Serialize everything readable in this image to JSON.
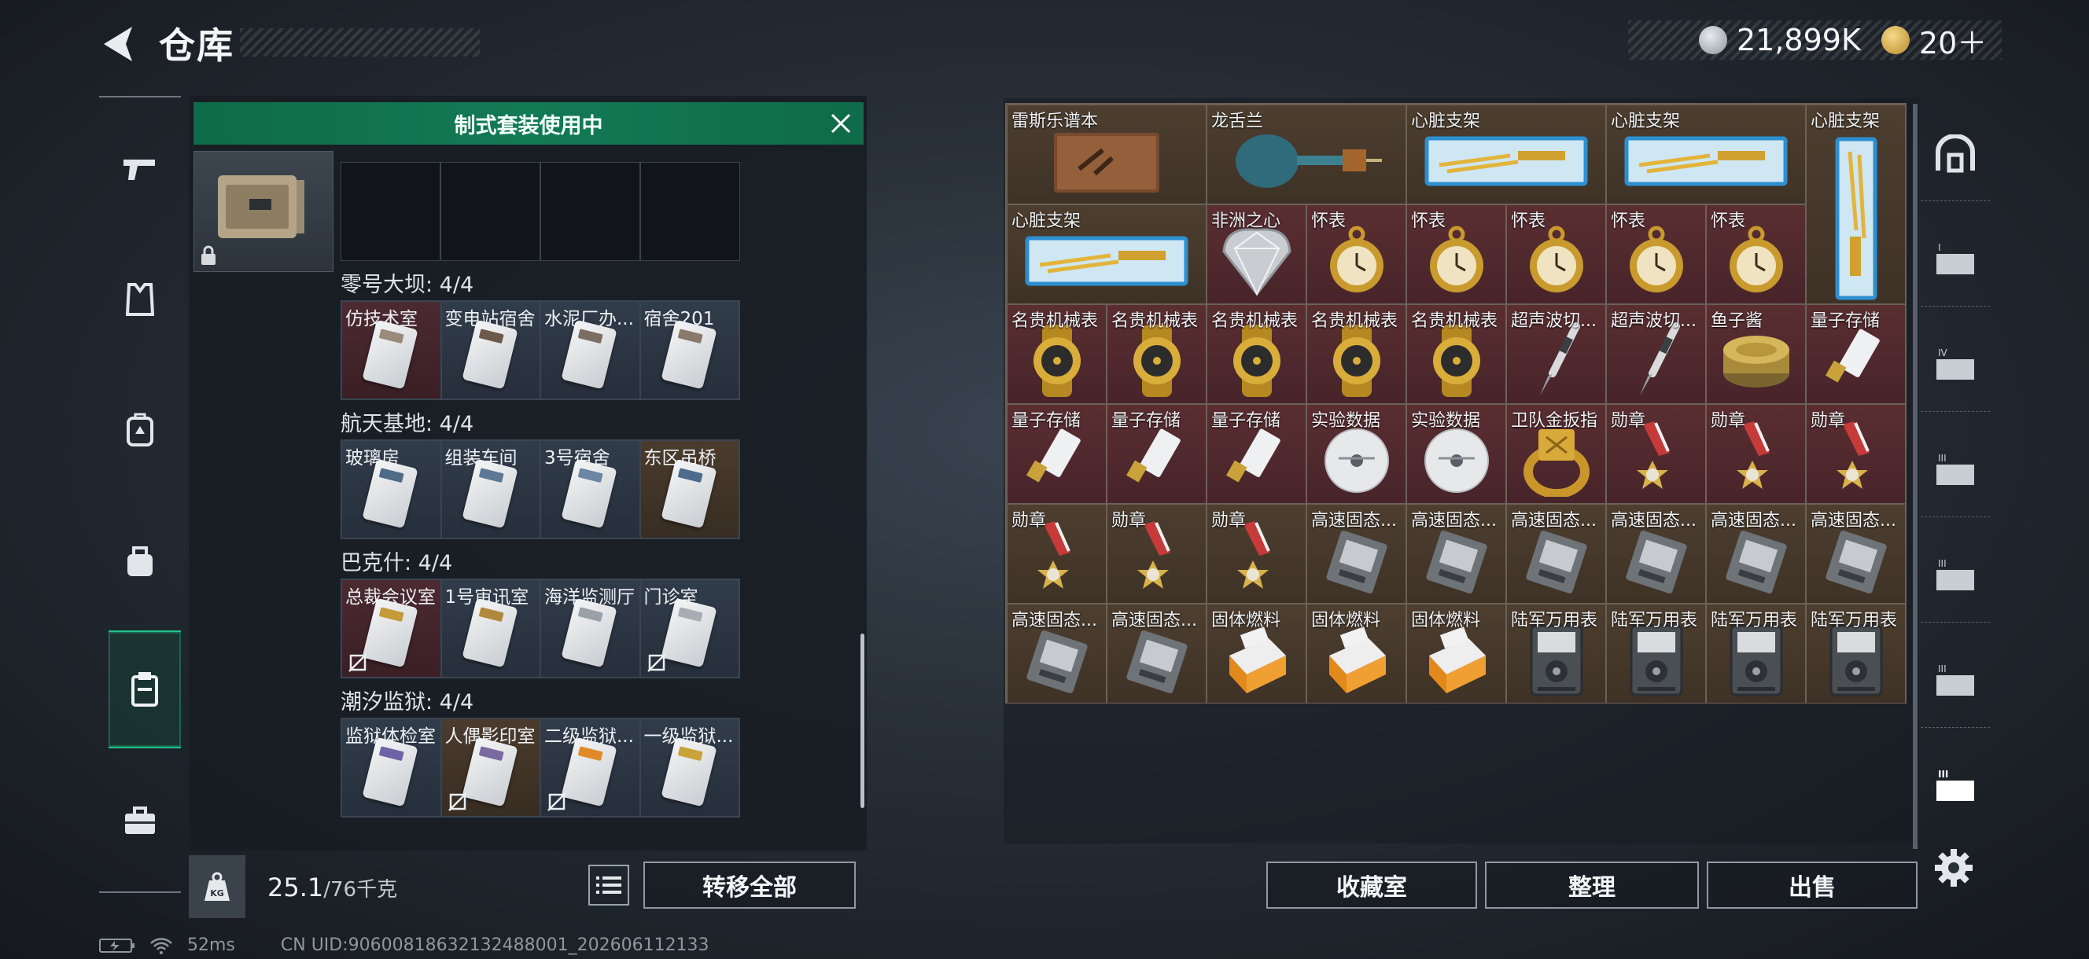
{
  "header": {
    "title": "仓库",
    "currency_1": "21,899K",
    "currency_2": "20＋"
  },
  "kit": {
    "banner": "制式套装使用中"
  },
  "sections": [
    {
      "title": "零号大坝: 4/4",
      "cards": [
        {
          "label": "仿技术室",
          "tone": "red",
          "locked": false,
          "color": "#9a8a7a"
        },
        {
          "label": "变电站宿舍",
          "tone": "blue",
          "locked": false,
          "color": "#6b5a4c"
        },
        {
          "label": "水泥厂办...",
          "tone": "blue",
          "locked": false,
          "color": "#7a6e62"
        },
        {
          "label": "宿舍201",
          "tone": "blue",
          "locked": false,
          "color": "#8a7a6c"
        }
      ]
    },
    {
      "title": "航天基地: 4/4",
      "cards": [
        {
          "label": "玻璃房",
          "tone": "blue",
          "locked": false,
          "color": "#4f6b86"
        },
        {
          "label": "组装车间",
          "tone": "blue",
          "locked": false,
          "color": "#5c7894"
        },
        {
          "label": "3号宿舍",
          "tone": "blue",
          "locked": false,
          "color": "#6a86a2"
        },
        {
          "label": "东区吊桥",
          "tone": "brown",
          "locked": false,
          "color": "#4d6b8a"
        }
      ]
    },
    {
      "title": "巴克什: 4/4",
      "cards": [
        {
          "label": "总裁会议室",
          "tone": "red",
          "locked": true,
          "color": "#c59a3a"
        },
        {
          "label": "1号审讯室",
          "tone": "blue",
          "locked": false,
          "color": "#b08a3c"
        },
        {
          "label": "海洋监测厅",
          "tone": "blue",
          "locked": false,
          "color": "#9aa0a8"
        },
        {
          "label": "门诊室",
          "tone": "blue",
          "locked": true,
          "color": "#a8adb3"
        }
      ]
    },
    {
      "title": "潮汐监狱: 4/4",
      "cards": [
        {
          "label": "监狱体检室",
          "tone": "blue",
          "locked": false,
          "color": "#6e63a8"
        },
        {
          "label": "人偶影印室",
          "tone": "brown",
          "locked": true,
          "color": "#7a6aa0"
        },
        {
          "label": "二级监狱...",
          "tone": "blue",
          "locked": true,
          "color": "#e08a2a"
        },
        {
          "label": "一级监狱...",
          "tone": "blue",
          "locked": false,
          "color": "#c9a23a"
        }
      ]
    }
  ],
  "weight": {
    "current": "25.1",
    "max": "/76千克"
  },
  "buttons": {
    "transfer_all": "转移全部",
    "collection": "收藏室",
    "sort": "整理",
    "sell": "出售"
  },
  "items": [
    {
      "label": "雷斯乐谱本",
      "icon": "book-icon",
      "bg": "b"
    },
    {
      "label": "龙舌兰",
      "icon": "bottle-icon",
      "bg": "b"
    },
    {
      "label": "",
      "icon": "",
      "bg": "b"
    },
    {
      "label": "心脏支架",
      "icon": "stent-box-icon",
      "bg": "b"
    },
    {
      "label": "",
      "icon": "",
      "bg": "b"
    },
    {
      "label": "心脏支架",
      "icon": "stent-box-icon",
      "bg": "b"
    },
    {
      "label": "",
      "icon": "",
      "bg": "b"
    },
    {
      "label": "心脏支架",
      "icon": "stent-box-vertical-icon",
      "bg": "b"
    },
    {
      "label": "心脏支架",
      "icon": "stent-box-icon",
      "bg": "b"
    },
    {
      "label": "",
      "icon": "",
      "bg": "b"
    },
    {
      "label": "非洲之心",
      "icon": "diamond-icon",
      "bg": "r"
    },
    {
      "label": "怀表",
      "icon": "pocket-watch-icon",
      "bg": "r"
    },
    {
      "label": "怀表",
      "icon": "pocket-watch-icon",
      "bg": "r"
    },
    {
      "label": "怀表",
      "icon": "pocket-watch-icon",
      "bg": "r"
    },
    {
      "label": "怀表",
      "icon": "pocket-watch-icon",
      "bg": "r"
    },
    {
      "label": "怀表",
      "icon": "pocket-watch-icon",
      "bg": "r"
    },
    {
      "label": "名贵机械表",
      "icon": "wristwatch-icon",
      "bg": "r"
    },
    {
      "label": "名贵机械表",
      "icon": "wristwatch-icon",
      "bg": "r"
    },
    {
      "label": "名贵机械表",
      "icon": "wristwatch-icon",
      "bg": "r"
    },
    {
      "label": "名贵机械表",
      "icon": "wristwatch-icon",
      "bg": "r"
    },
    {
      "label": "名贵机械表",
      "icon": "wristwatch-icon",
      "bg": "r"
    },
    {
      "label": "超声波切...",
      "icon": "scalpel-icon",
      "bg": "r"
    },
    {
      "label": "超声波切...",
      "icon": "scalpel-icon",
      "bg": "r"
    },
    {
      "label": "鱼子酱",
      "icon": "caviar-tin-icon",
      "bg": "r"
    },
    {
      "label": "量子存储",
      "icon": "usb-drive-icon",
      "bg": "r"
    },
    {
      "label": "量子存储",
      "icon": "usb-drive-icon",
      "bg": "r"
    },
    {
      "label": "量子存储",
      "icon": "usb-drive-icon",
      "bg": "r"
    },
    {
      "label": "量子存储",
      "icon": "usb-drive-icon",
      "bg": "r"
    },
    {
      "label": "实验数据",
      "icon": "disc-icon",
      "bg": "r"
    },
    {
      "label": "实验数据",
      "icon": "disc-icon",
      "bg": "r"
    },
    {
      "label": "卫队金扳指",
      "icon": "gold-ring-icon",
      "bg": "r"
    },
    {
      "label": "勋章",
      "icon": "medal-icon",
      "bg": "r"
    },
    {
      "label": "勋章",
      "icon": "medal-icon",
      "bg": "r"
    },
    {
      "label": "勋章",
      "icon": "medal-icon",
      "bg": "r"
    },
    {
      "label": "勋章",
      "icon": "medal-icon",
      "bg": "b"
    },
    {
      "label": "勋章",
      "icon": "medal-icon",
      "bg": "b"
    },
    {
      "label": "勋章",
      "icon": "medal-icon",
      "bg": "b"
    },
    {
      "label": "高速固态...",
      "icon": "ssd-icon",
      "bg": "b"
    },
    {
      "label": "高速固态...",
      "icon": "ssd-icon",
      "bg": "b"
    },
    {
      "label": "高速固态...",
      "icon": "ssd-icon",
      "bg": "b"
    },
    {
      "label": "高速固态...",
      "icon": "ssd-icon",
      "bg": "b"
    },
    {
      "label": "高速固态...",
      "icon": "ssd-icon",
      "bg": "b"
    },
    {
      "label": "高速固态...",
      "icon": "ssd-icon",
      "bg": "b"
    },
    {
      "label": "高速固态...",
      "icon": "ssd-icon",
      "bg": "b"
    },
    {
      "label": "高速固态...",
      "icon": "ssd-icon",
      "bg": "b"
    },
    {
      "label": "固体燃料",
      "icon": "fuel-pack-icon",
      "bg": "b"
    },
    {
      "label": "固体燃料",
      "icon": "fuel-pack-icon",
      "bg": "b"
    },
    {
      "label": "固体燃料",
      "icon": "fuel-pack-icon",
      "bg": "b"
    },
    {
      "label": "陆军万用表",
      "icon": "multimeter-icon",
      "bg": "b"
    },
    {
      "label": "陆军万用表",
      "icon": "multimeter-icon",
      "bg": "b"
    },
    {
      "label": "陆军万用表",
      "icon": "multimeter-icon",
      "bg": "b"
    },
    {
      "label": "陆军万用表",
      "icon": "multimeter-icon",
      "bg": "b"
    }
  ],
  "status": {
    "ping": "52ms",
    "uid": "CN UID:9060081863213248800​1_202606112133"
  },
  "colors": {
    "accent": "#22c38a",
    "banner": "#137a56",
    "red_cell": "#5a2e31",
    "brown_cell": "#4d3e2f"
  }
}
